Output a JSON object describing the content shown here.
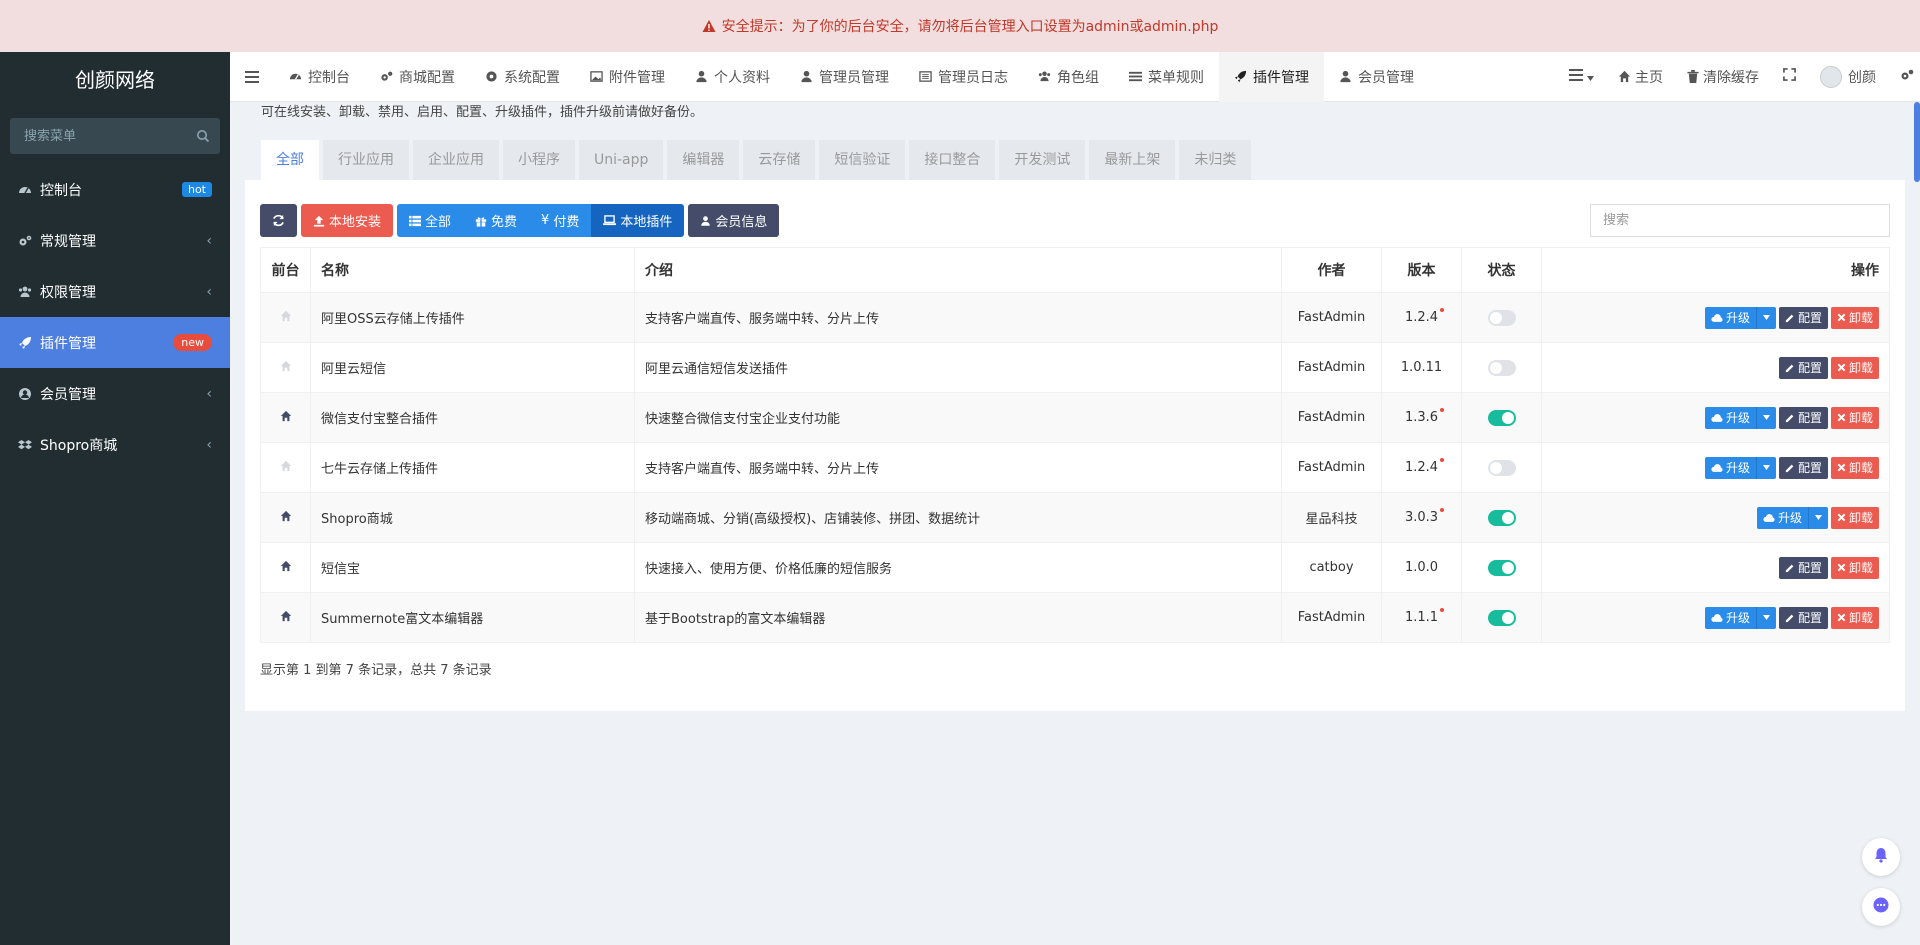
{
  "alert": {
    "text": "安全提示：为了你的后台安全，请勿将后台管理入口设置为admin或admin.php"
  },
  "sidebar": {
    "logo": "创颜网络",
    "search_placeholder": "搜索菜单",
    "items": [
      {
        "label": "控制台",
        "icon": "dashboard-icon",
        "badge": "hot"
      },
      {
        "label": "常规管理",
        "icon": "cogs-icon"
      },
      {
        "label": "权限管理",
        "icon": "group-icon"
      },
      {
        "label": "插件管理",
        "icon": "rocket-icon",
        "badge": "new",
        "active": true
      },
      {
        "label": "会员管理",
        "icon": "user-circle-icon"
      },
      {
        "label": "Shopro商城",
        "icon": "dropbox-icon"
      }
    ]
  },
  "topbar": {
    "nav": [
      {
        "label": "控制台",
        "icon": "dashboard-icon"
      },
      {
        "label": "商城配置",
        "icon": "cogs-icon"
      },
      {
        "label": "系统配置",
        "icon": "cog-icon"
      },
      {
        "label": "附件管理",
        "icon": "image-icon"
      },
      {
        "label": "个人资料",
        "icon": "user-icon"
      },
      {
        "label": "管理员管理",
        "icon": "user-icon"
      },
      {
        "label": "管理员日志",
        "icon": "list-alt-icon"
      },
      {
        "label": "角色组",
        "icon": "group-icon"
      },
      {
        "label": "菜单规则",
        "icon": "bars-icon"
      },
      {
        "label": "插件管理",
        "icon": "rocket-icon",
        "active": true
      },
      {
        "label": "会员管理",
        "icon": "user-icon"
      }
    ],
    "right": {
      "home": "主页",
      "clear_cache": "清除缓存",
      "user": "创颜"
    }
  },
  "page": {
    "description": "可在线安装、卸载、禁用、启用、配置、升级插件，插件升级前请做好备份。",
    "tabs": [
      "全部",
      "行业应用",
      "企业应用",
      "小程序",
      "Uni-app",
      "编辑器",
      "云存储",
      "短信验证",
      "接口整合",
      "开发测试",
      "最新上架",
      "未归类"
    ],
    "toolbar": {
      "local_install": "本地安装",
      "filter_all": "全部",
      "filter_free": "免费",
      "filter_paid": "付费",
      "local_plugins": "本地插件",
      "member_info": "会员信息",
      "search_placeholder": "搜索"
    },
    "table": {
      "headers": {
        "front": "前台",
        "name": "名称",
        "intro": "介绍",
        "author": "作者",
        "version": "版本",
        "status": "状态",
        "ops": "操作"
      },
      "rows": [
        {
          "name": "阿里OSS云存储上传插件",
          "intro": "支持客户端直传、服务端中转、分片上传",
          "author": "FastAdmin",
          "version": "1.2.4",
          "update_dot": true,
          "enabled": false,
          "front_active": false,
          "upgrade": true,
          "config": true
        },
        {
          "name": "阿里云短信",
          "intro": "阿里云通信短信发送插件",
          "author": "FastAdmin",
          "version": "1.0.11",
          "update_dot": false,
          "enabled": false,
          "front_active": false,
          "upgrade": false,
          "config": true
        },
        {
          "name": "微信支付宝整合插件",
          "intro": "快速整合微信支付宝企业支付功能",
          "author": "FastAdmin",
          "version": "1.3.6",
          "update_dot": true,
          "enabled": true,
          "front_active": true,
          "upgrade": true,
          "config": true
        },
        {
          "name": "七牛云存储上传插件",
          "intro": "支持客户端直传、服务端中转、分片上传",
          "author": "FastAdmin",
          "version": "1.2.4",
          "update_dot": true,
          "enabled": false,
          "front_active": false,
          "upgrade": true,
          "config": true
        },
        {
          "name": "Shopro商城",
          "intro": "移动端商城、分销(高级授权)、店铺装修、拼团、数据统计",
          "author": "星品科技",
          "version": "3.0.3",
          "update_dot": true,
          "enabled": true,
          "front_active": true,
          "upgrade": true,
          "config": false
        },
        {
          "name": "短信宝",
          "intro": "快速接入、使用方便、价格低廉的短信服务",
          "author": "catboy",
          "version": "1.0.0",
          "update_dot": false,
          "enabled": true,
          "front_active": true,
          "upgrade": false,
          "config": true
        },
        {
          "name": "Summernote富文本编辑器",
          "intro": "基于Bootstrap的富文本编辑器",
          "author": "FastAdmin",
          "version": "1.1.1",
          "update_dot": true,
          "enabled": true,
          "front_active": true,
          "upgrade": true,
          "config": true
        }
      ],
      "actions": {
        "upgrade": "升级",
        "config": "配置",
        "uninstall": "卸载"
      }
    },
    "footer": "显示第 1 到第 7 条记录，总共 7 条记录"
  },
  "colors": {
    "accent": "#4d7fe0",
    "sidebar_bg": "#222d32",
    "danger": "#ec5b4f",
    "success": "#18bc9c",
    "primary": "#2a8ce8"
  }
}
